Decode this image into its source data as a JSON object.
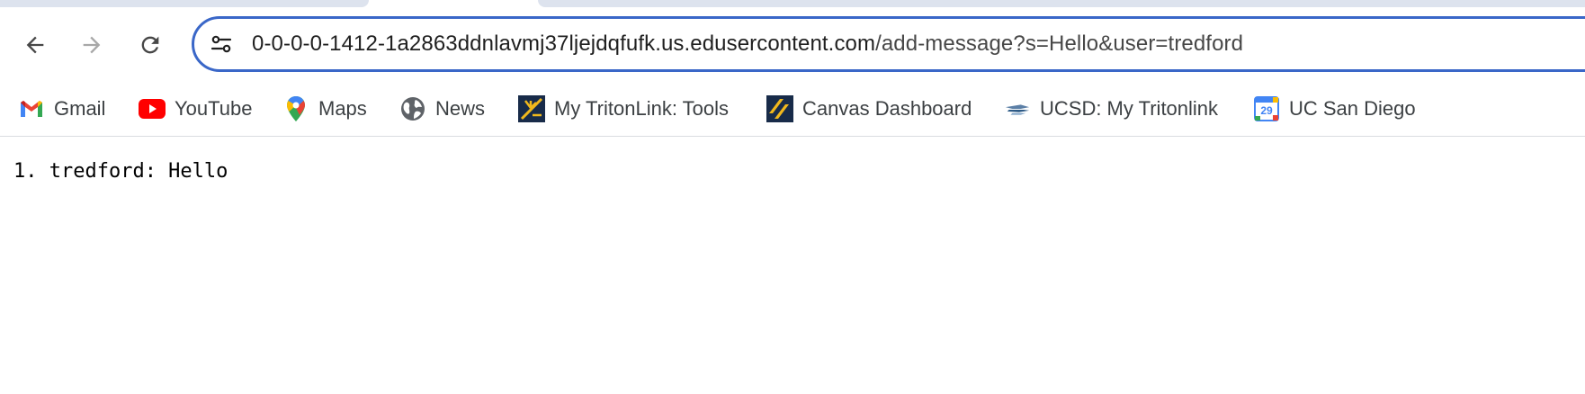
{
  "browser": {
    "url_host": "0-0-0-0-1412-1a2863ddnlavmj37ljejdqfufk.us.edusercontent.com",
    "url_path": "/add-message?s=Hello&user=tredford",
    "buttons": {
      "back_icon": "back-arrow-icon",
      "forward_icon": "forward-arrow-icon",
      "reload_icon": "reload-icon",
      "site_info_icon": "tune-icon"
    },
    "colors": {
      "omnibox_border": "#3a67c8",
      "tab_strip": "#dde3ee"
    }
  },
  "bookmarks": [
    {
      "label": "Gmail",
      "icon": "gmail-icon"
    },
    {
      "label": "YouTube",
      "icon": "youtube-icon"
    },
    {
      "label": "Maps",
      "icon": "maps-icon"
    },
    {
      "label": "News",
      "icon": "news-globe-icon"
    },
    {
      "label": "My TritonLink: Tools",
      "icon": "tritonlink-icon"
    },
    {
      "label": "Canvas Dashboard",
      "icon": "canvas-icon"
    },
    {
      "label": "UCSD: My Tritonlink",
      "icon": "ucsd-icon"
    },
    {
      "label": "UC San Diego",
      "icon": "calendar-icon",
      "calendar_day": "29"
    }
  ],
  "page": {
    "messages": [
      {
        "number": "1.",
        "user": "tredford",
        "text": "Hello",
        "display": "1. tredford: Hello"
      }
    ]
  }
}
